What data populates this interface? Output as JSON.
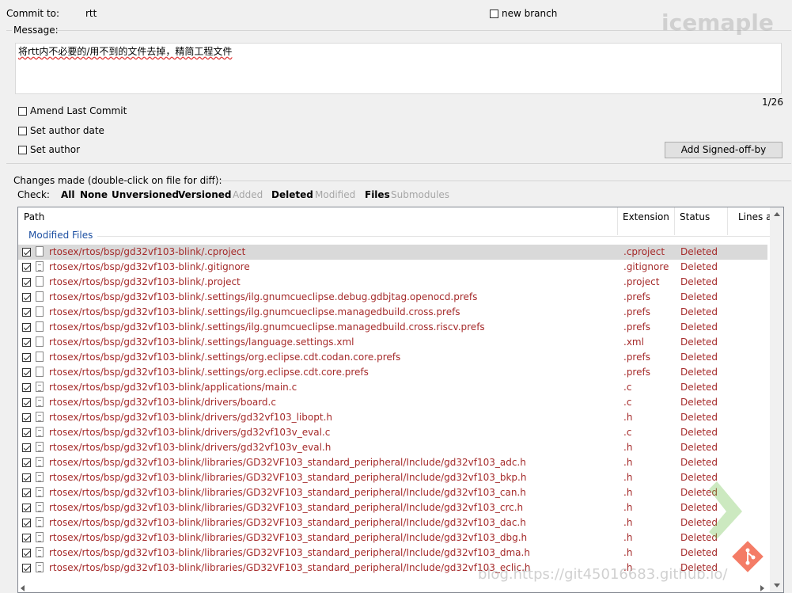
{
  "top": {
    "commit_to_label": "Commit to:",
    "branch": "rtt",
    "new_branch_label": "new branch",
    "message_label": "Message:",
    "message_text": "将rtt内不必要的/用不到的文件去掉，精简工程文件",
    "char_counter": "1/26"
  },
  "options": {
    "amend": "Amend Last Commit",
    "author_date": "Set author date",
    "author": "Set author",
    "signed_off_button": "Add Signed-off-by"
  },
  "changes": {
    "group_label": "Changes made (double-click on file for diff):",
    "check_label": "Check:",
    "filters": [
      {
        "label": "All",
        "enabled": true
      },
      {
        "label": "None",
        "enabled": true
      },
      {
        "label": "Unversioned",
        "enabled": true
      },
      {
        "label": "Versioned",
        "enabled": true
      },
      {
        "label": "Added",
        "enabled": false
      },
      {
        "label": "Deleted",
        "enabled": true
      },
      {
        "label": "Modified",
        "enabled": false
      },
      {
        "label": "Files",
        "enabled": true
      },
      {
        "label": "Submodules",
        "enabled": false
      }
    ]
  },
  "list": {
    "columns": {
      "path": "Path",
      "extension": "Extension",
      "status": "Status",
      "lines": "Lines a"
    },
    "group": "Modified Files",
    "rows": [
      {
        "path": "rtosex/rtos/bsp/gd32vf103-blink/.cproject",
        "ext": ".cproject",
        "status": "Deleted",
        "icon": "file-icon"
      },
      {
        "path": "rtosex/rtos/bsp/gd32vf103-blink/.gitignore",
        "ext": ".gitignore",
        "status": "Deleted",
        "icon": "text-file-icon"
      },
      {
        "path": "rtosex/rtos/bsp/gd32vf103-blink/.project",
        "ext": ".project",
        "status": "Deleted",
        "icon": "file-icon"
      },
      {
        "path": "rtosex/rtos/bsp/gd32vf103-blink/.settings/ilg.gnumcueclipse.debug.gdbjtag.openocd.prefs",
        "ext": ".prefs",
        "status": "Deleted",
        "icon": "file-icon"
      },
      {
        "path": "rtosex/rtos/bsp/gd32vf103-blink/.settings/ilg.gnumcueclipse.managedbuild.cross.prefs",
        "ext": ".prefs",
        "status": "Deleted",
        "icon": "file-icon"
      },
      {
        "path": "rtosex/rtos/bsp/gd32vf103-blink/.settings/ilg.gnumcueclipse.managedbuild.cross.riscv.prefs",
        "ext": ".prefs",
        "status": "Deleted",
        "icon": "file-icon"
      },
      {
        "path": "rtosex/rtos/bsp/gd32vf103-blink/.settings/language.settings.xml",
        "ext": ".xml",
        "status": "Deleted",
        "icon": "file-icon"
      },
      {
        "path": "rtosex/rtos/bsp/gd32vf103-blink/.settings/org.eclipse.cdt.codan.core.prefs",
        "ext": ".prefs",
        "status": "Deleted",
        "icon": "file-icon"
      },
      {
        "path": "rtosex/rtos/bsp/gd32vf103-blink/.settings/org.eclipse.cdt.core.prefs",
        "ext": ".prefs",
        "status": "Deleted",
        "icon": "file-icon"
      },
      {
        "path": "rtosex/rtos/bsp/gd32vf103-blink/applications/main.c",
        "ext": ".c",
        "status": "Deleted",
        "icon": "text-file-icon"
      },
      {
        "path": "rtosex/rtos/bsp/gd32vf103-blink/drivers/board.c",
        "ext": ".c",
        "status": "Deleted",
        "icon": "text-file-icon"
      },
      {
        "path": "rtosex/rtos/bsp/gd32vf103-blink/drivers/gd32vf103_libopt.h",
        "ext": ".h",
        "status": "Deleted",
        "icon": "text-file-icon"
      },
      {
        "path": "rtosex/rtos/bsp/gd32vf103-blink/drivers/gd32vf103v_eval.c",
        "ext": ".c",
        "status": "Deleted",
        "icon": "text-file-icon"
      },
      {
        "path": "rtosex/rtos/bsp/gd32vf103-blink/drivers/gd32vf103v_eval.h",
        "ext": ".h",
        "status": "Deleted",
        "icon": "text-file-icon"
      },
      {
        "path": "rtosex/rtos/bsp/gd32vf103-blink/libraries/GD32VF103_standard_peripheral/Include/gd32vf103_adc.h",
        "ext": ".h",
        "status": "Deleted",
        "icon": "text-file-icon"
      },
      {
        "path": "rtosex/rtos/bsp/gd32vf103-blink/libraries/GD32VF103_standard_peripheral/Include/gd32vf103_bkp.h",
        "ext": ".h",
        "status": "Deleted",
        "icon": "text-file-icon"
      },
      {
        "path": "rtosex/rtos/bsp/gd32vf103-blink/libraries/GD32VF103_standard_peripheral/Include/gd32vf103_can.h",
        "ext": ".h",
        "status": "Deleted",
        "icon": "text-file-icon"
      },
      {
        "path": "rtosex/rtos/bsp/gd32vf103-blink/libraries/GD32VF103_standard_peripheral/Include/gd32vf103_crc.h",
        "ext": ".h",
        "status": "Deleted",
        "icon": "text-file-icon"
      },
      {
        "path": "rtosex/rtos/bsp/gd32vf103-blink/libraries/GD32VF103_standard_peripheral/Include/gd32vf103_dac.h",
        "ext": ".h",
        "status": "Deleted",
        "icon": "text-file-icon"
      },
      {
        "path": "rtosex/rtos/bsp/gd32vf103-blink/libraries/GD32VF103_standard_peripheral/Include/gd32vf103_dbg.h",
        "ext": ".h",
        "status": "Deleted",
        "icon": "text-file-icon"
      },
      {
        "path": "rtosex/rtos/bsp/gd32vf103-blink/libraries/GD32VF103_standard_peripheral/Include/gd32vf103_dma.h",
        "ext": ".h",
        "status": "Deleted",
        "icon": "text-file-icon"
      },
      {
        "path": "rtosex/rtos/bsp/gd32vf103-blink/libraries/GD32VF103_standard_peripheral/Include/gd32vf103_eclic.h",
        "ext": ".h",
        "status": "Deleted",
        "icon": "text-file-icon"
      }
    ]
  },
  "watermarks": {
    "top_right": "icemaple",
    "bottom": "blog.https://git45016683.github.io/"
  }
}
